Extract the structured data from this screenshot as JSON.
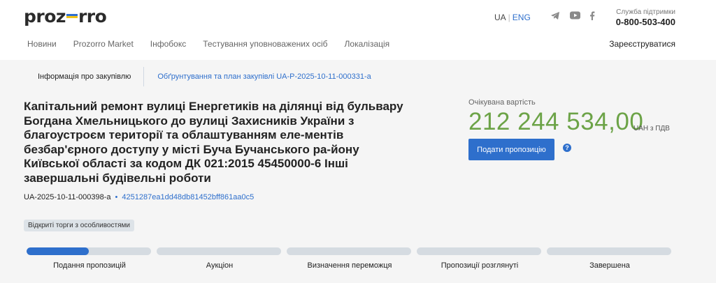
{
  "header": {
    "logo_text_left": "proz",
    "logo_text_right": "rro",
    "lang_ua": "UA",
    "lang_sep": "|",
    "lang_eng": "ENG",
    "support_label": "Служба підтримки",
    "support_phone": "0-800-503-400"
  },
  "nav": {
    "items": [
      "Новини",
      "Prozorro Market",
      "Інфобокс",
      "Тестування уповноважених осіб",
      "Локалізація"
    ],
    "register": "Зареєструватися"
  },
  "tabs": {
    "active": "Інформація про закупівлю",
    "link": "Обґрунтування та план закупівлі UA-P-2025-10-11-000331-a"
  },
  "tender": {
    "title": "Капітальний ремонт вулиці Енергетиків на ділянці від бульвару Богдана Хмельницького до вулиці Захисників України з благоустроєм території та облаштуванням еле-ментів безбар'єрного доступу у місті Буча Бучанського ра-йону Київської області за кодом ДК 021:2015 45450000-6 Інші завершальні будівельні роботи",
    "id": "UA-2025-10-11-000398-a",
    "separator": "•",
    "hash": "4251287ea1dd48db81452bff861aa0c5",
    "badge": "Відкриті торги з особливостями"
  },
  "price": {
    "label": "Очікувана вартість",
    "value": "212 244 534,00",
    "currency": "UAH з ПДВ",
    "submit_label": "Подати пропозицію",
    "help_icon": "?"
  },
  "stages": [
    {
      "label": "Подання пропозицій",
      "progress": 0.5
    },
    {
      "label": "Аукціон",
      "progress": 0
    },
    {
      "label": "Визначення переможця",
      "progress": 0
    },
    {
      "label": "Пропозиції розглянуті",
      "progress": 0
    },
    {
      "label": "Завершена",
      "progress": 0
    }
  ],
  "colors": {
    "accent": "#2e6fcc",
    "price": "#6ca347",
    "background": "#f5f5f5"
  },
  "icons": [
    "telegram-icon",
    "youtube-icon",
    "facebook-icon",
    "help-icon"
  ]
}
